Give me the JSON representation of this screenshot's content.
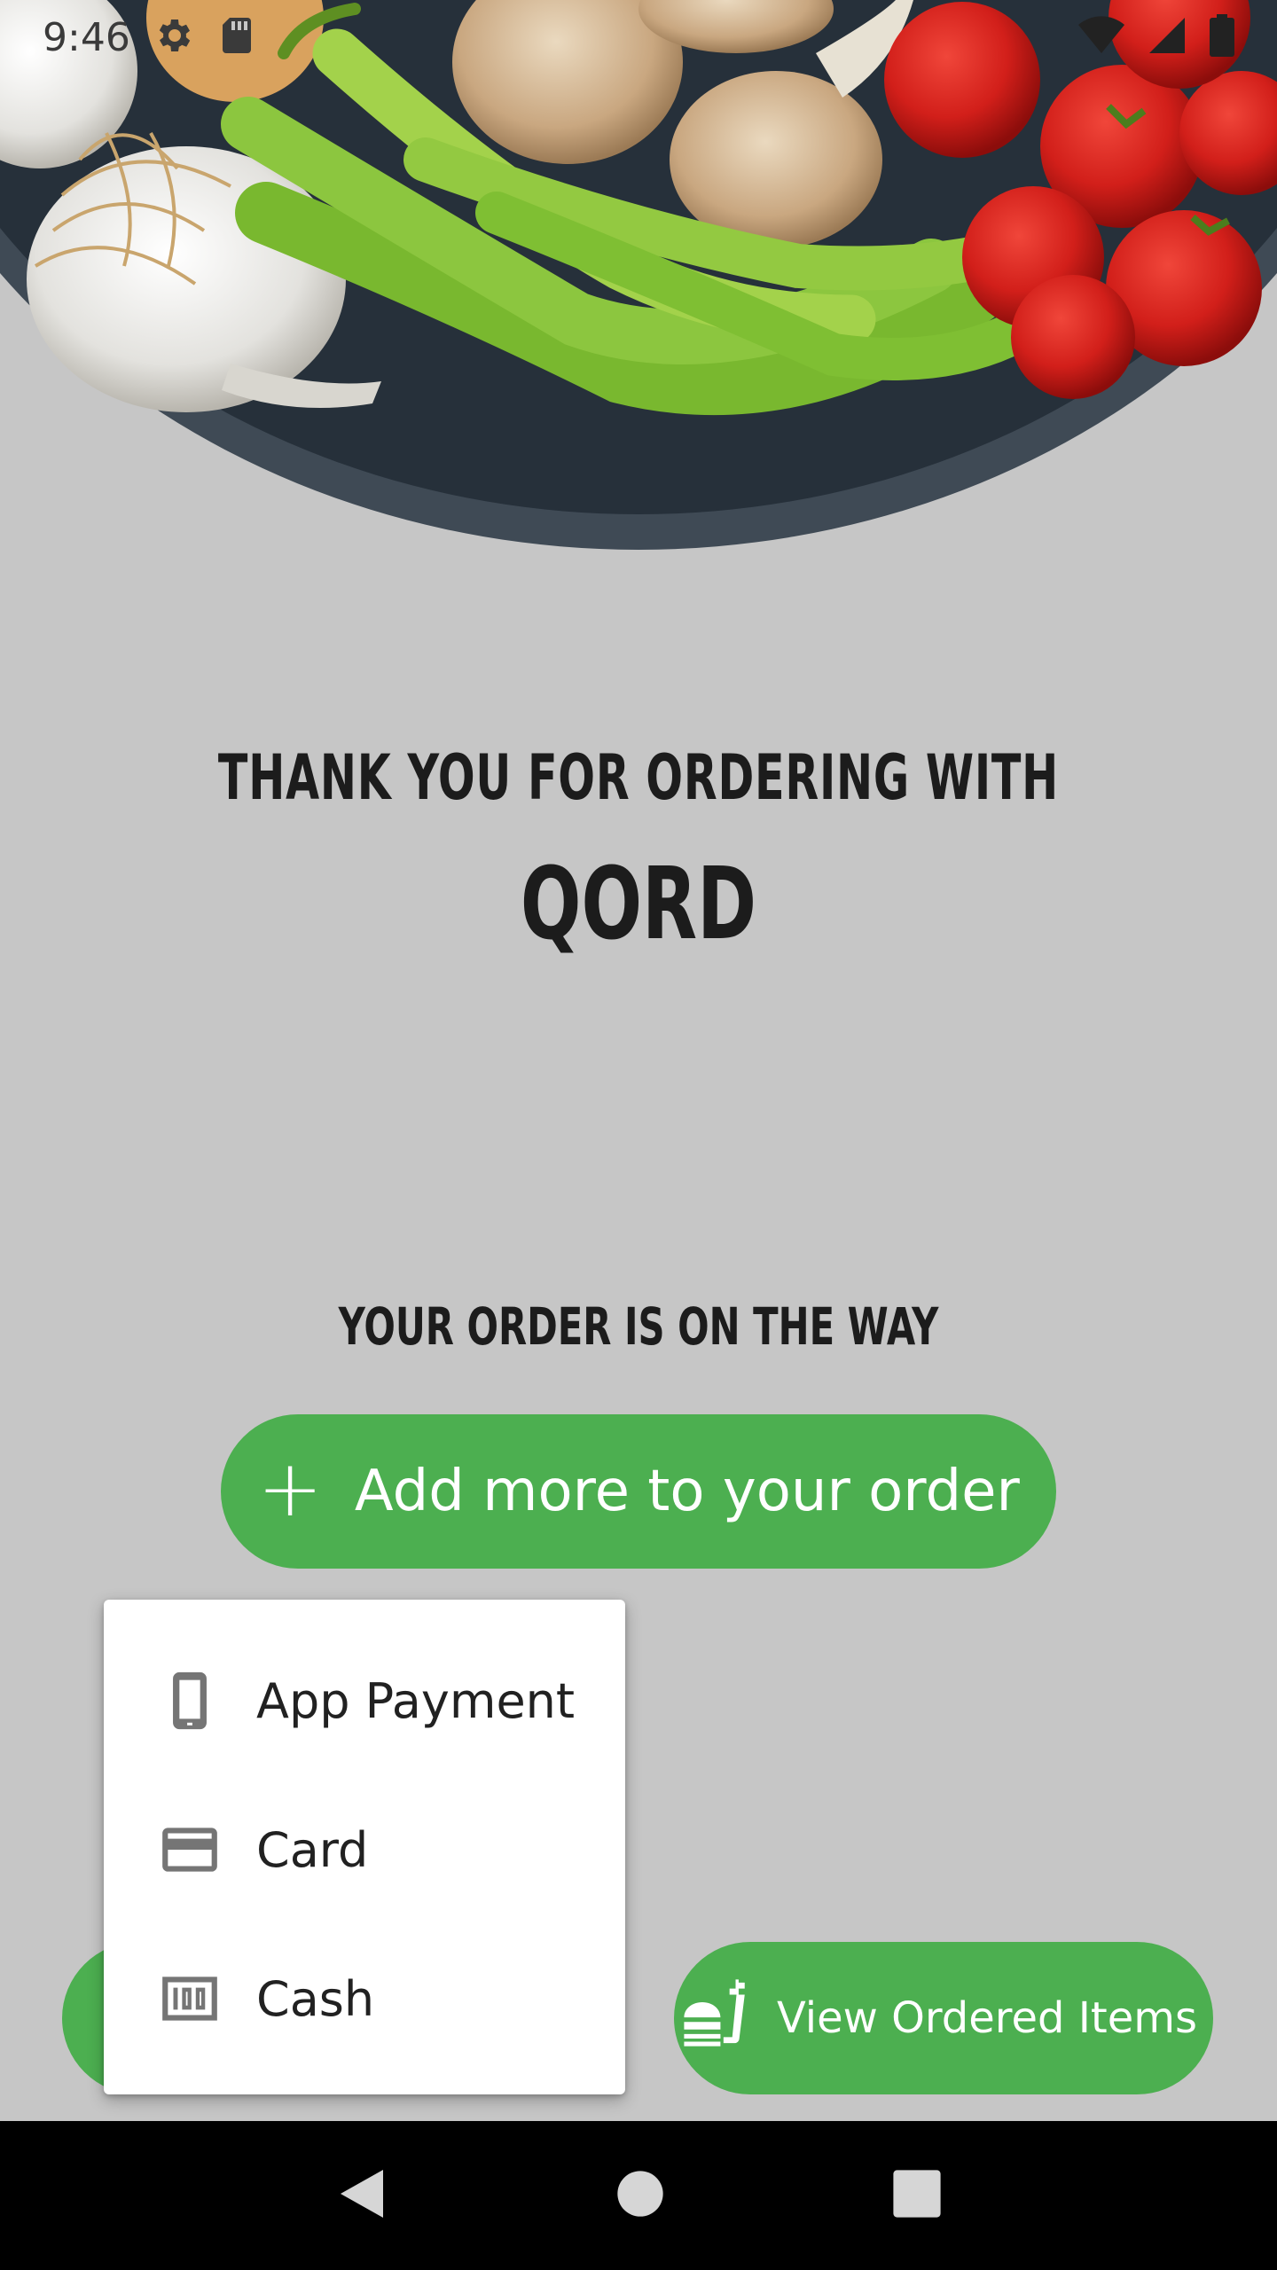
{
  "status_bar": {
    "time": "9:46",
    "icons_left": [
      "settings-icon",
      "sd-card-icon"
    ],
    "icons_right": [
      "wifi-icon",
      "signal-icon",
      "battery-icon"
    ]
  },
  "hero": {
    "image": "vegetables-pan-image"
  },
  "headline": {
    "thanks": "THANK YOU FOR ORDERING WITH",
    "brand": "QORD",
    "status": "YOUR ORDER IS ON THE WAY"
  },
  "actions": {
    "add_more_icon": "plus-icon",
    "add_more_label": "Add more to your order",
    "view_items_icon": "food-order-icon",
    "view_items_label": "View Ordered Items"
  },
  "payment_menu": {
    "items": [
      {
        "icon": "phone-icon",
        "label": "App Payment"
      },
      {
        "icon": "credit-card-icon",
        "label": "Card"
      },
      {
        "icon": "cash-icon",
        "label": "Cash"
      }
    ]
  },
  "nav_bar": {
    "icons": [
      "back-icon",
      "home-icon",
      "recents-icon"
    ]
  },
  "colors": {
    "background": "#c6c6c6",
    "accent_green": "#4caf50",
    "text_dark": "#1c1c1c",
    "menu_bg": "#ffffff",
    "nav_bg": "#000000"
  }
}
